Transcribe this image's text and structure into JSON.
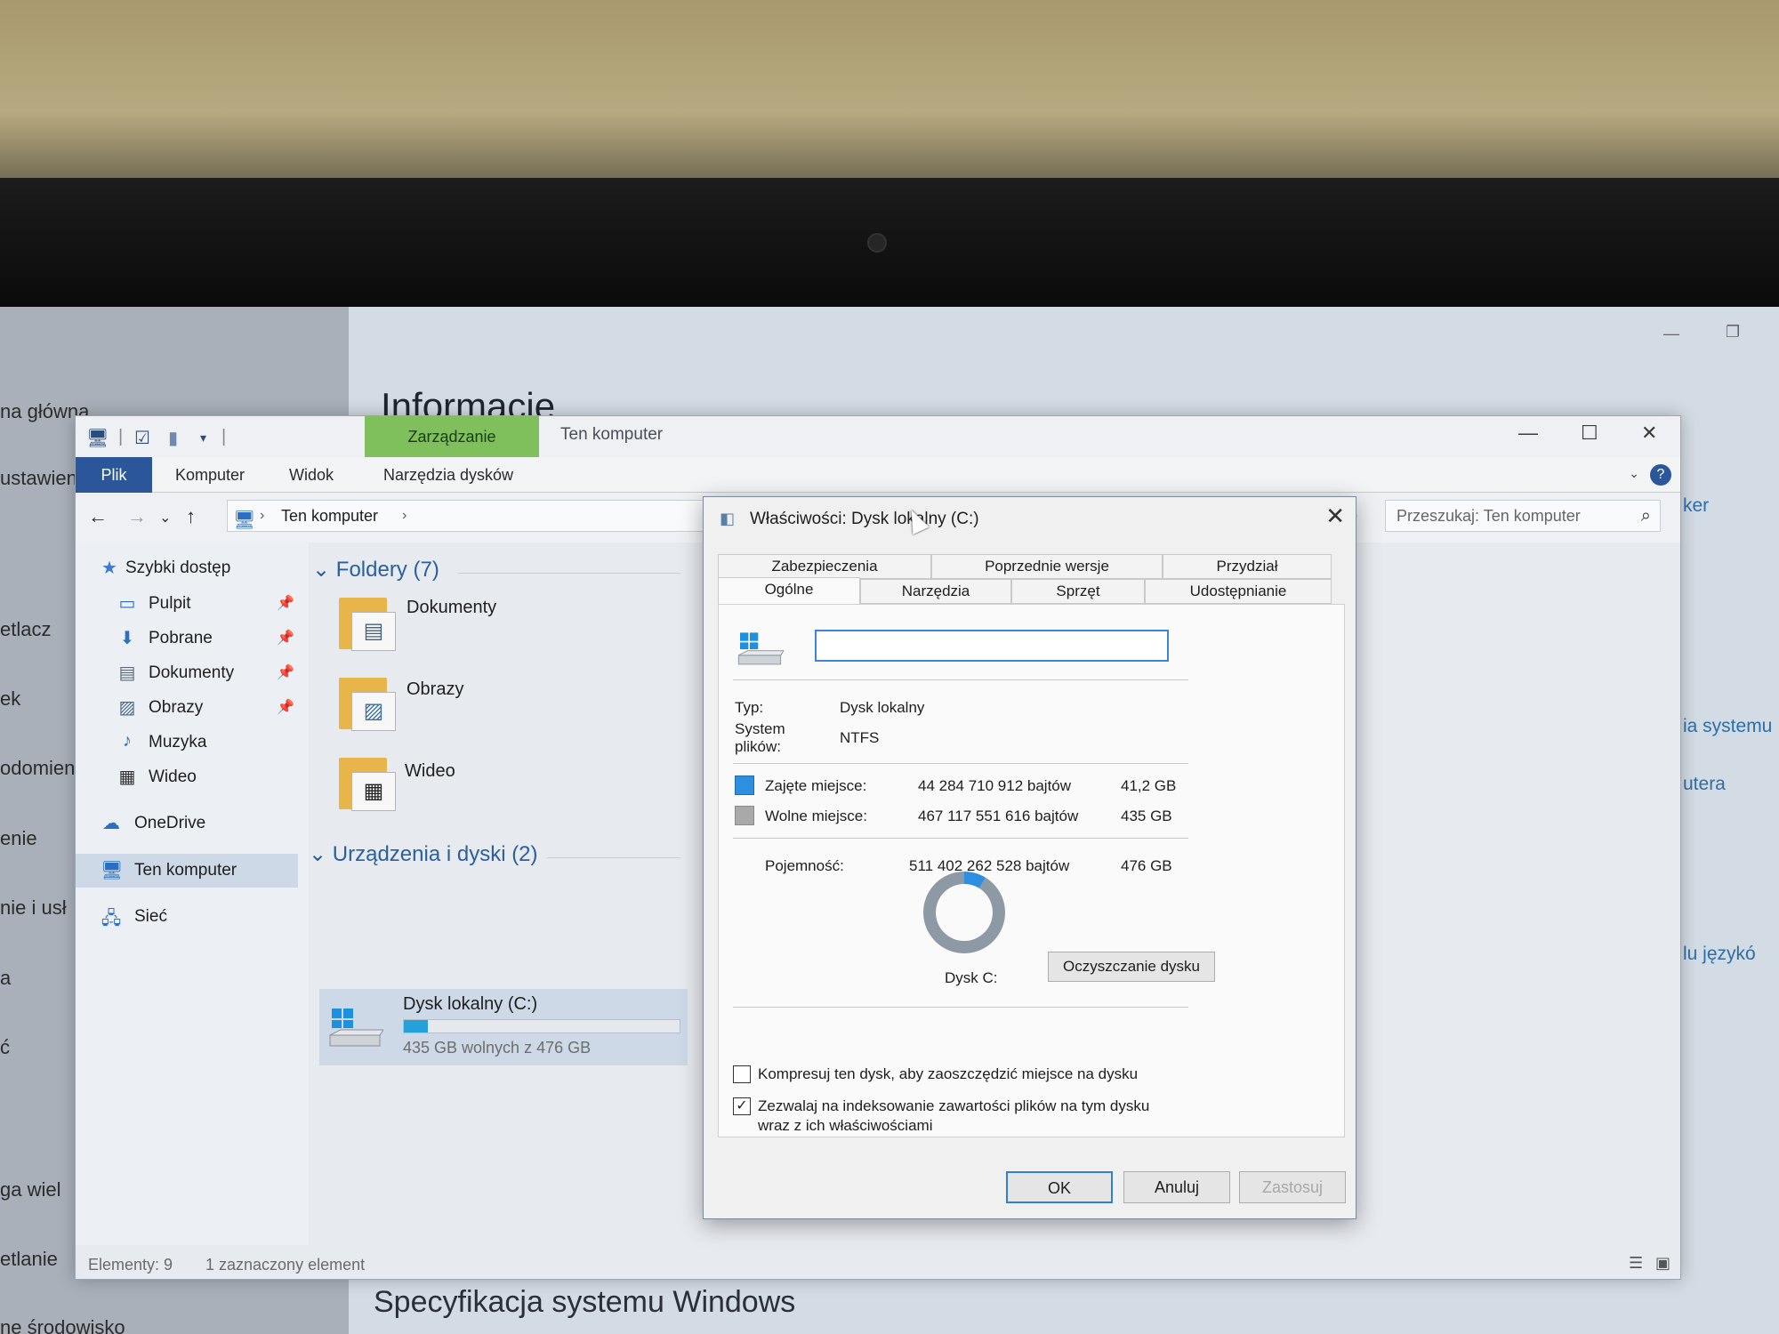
{
  "background_app": {
    "sidebar_items": [
      "na główna",
      "ustawienia",
      "etlacz",
      "ek",
      "odomien",
      "enie",
      "nie i usł",
      "a",
      "ć",
      "ga wiel",
      "etlanie",
      "ne środowisko"
    ],
    "title": "Informacje",
    "spec_heading": "Specyfikacja systemu Windows",
    "right_links": [
      "ker",
      "ia systemu",
      "utera",
      "lu językó"
    ]
  },
  "explorer": {
    "context_tab": "Zarządzanie",
    "window_title": "Ten komputer",
    "ribbon_tabs": [
      "Plik",
      "Komputer",
      "Widok",
      "Narzędzia dysków"
    ],
    "address_text": "Ten komputer",
    "search_placeholder": "Przeszukaj: Ten komputer",
    "nav": {
      "quick_access": "Szybki dostęp",
      "pinned": [
        "Pulpit",
        "Pobrane",
        "Dokumenty",
        "Obrazy"
      ],
      "unpinned": [
        "Muzyka",
        "Wideo"
      ],
      "onedrive": "OneDrive",
      "this_pc": "Ten komputer",
      "network": "Sieć"
    },
    "folders_header": "Foldery (7)",
    "folders": [
      "Dokumenty",
      "Obrazy",
      "Wideo"
    ],
    "devices_header": "Urządzenia i dyski (2)",
    "drive": {
      "name": "Dysk lokalny (C:)",
      "free_text": "435 GB wolnych z 476 GB",
      "used_fraction": 0.0866
    },
    "status": {
      "items": "Elementy: 9",
      "selected": "1 zaznaczony element"
    }
  },
  "dialog": {
    "title": "Właściwości: Dysk lokalny (C:)",
    "tabs_row1": [
      "Zabezpieczenia",
      "Poprzednie wersje",
      "Przydział"
    ],
    "tabs_row2": [
      "Ogólne",
      "Narzędzia",
      "Sprzęt",
      "Udostępnianie"
    ],
    "active_tab": "Ogólne",
    "name_value": "",
    "type_label": "Typ:",
    "type_value": "Dysk lokalny",
    "fs_label": "System plików:",
    "fs_value": "NTFS",
    "used_label": "Zajęte miejsce:",
    "used_bytes": "44 284 710 912 bajtów",
    "used_gb": "41,2 GB",
    "free_label": "Wolne miejsce:",
    "free_bytes": "467 117 551 616 bajtów",
    "free_gb": "435 GB",
    "capacity_label": "Pojemność:",
    "capacity_bytes": "511 402 262 528 bajtów",
    "capacity_gb": "476 GB",
    "used_fraction": 0.0866,
    "disk_label": "Dysk C:",
    "cleanup_button": "Oczyszczanie dysku",
    "compress_label": "Kompresuj ten dysk, aby zaoszczędzić miejsce na dysku",
    "compress_checked": false,
    "index_label_1": "Zezwalaj na indeksowanie zawartości plików na tym dysku",
    "index_label_2": "wraz z ich właściwościami",
    "index_checked": true,
    "buttons": {
      "ok": "OK",
      "cancel": "Anuluj",
      "apply": "Zastosuj"
    }
  },
  "colors": {
    "accent": "#2b579a",
    "manage_tab": "#7fbf5c",
    "used_space": "#2d8fe0",
    "free_space": "#a9a9a9",
    "drive_bar": "#26a0da"
  }
}
